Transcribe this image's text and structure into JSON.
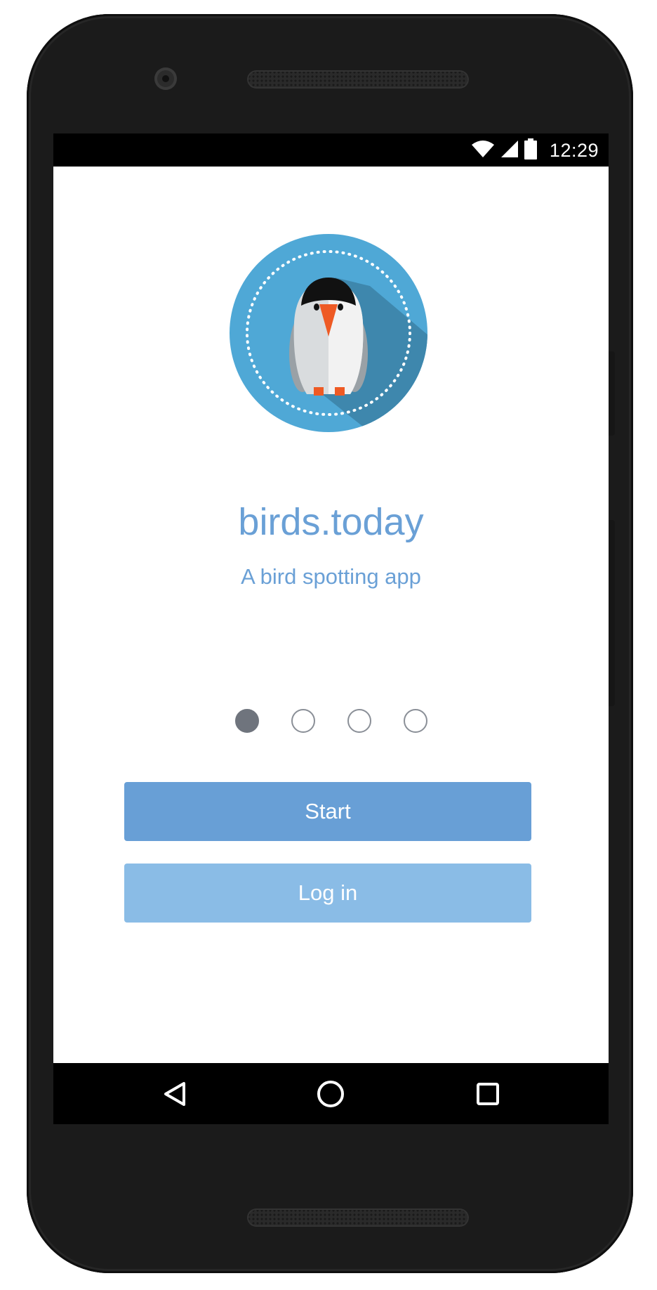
{
  "status_bar": {
    "time": "12:29",
    "icons": [
      "wifi-icon",
      "signal-icon",
      "battery-icon"
    ]
  },
  "app": {
    "name": "birds.today",
    "tagline": "A bird spotting app",
    "logo_icon": "bird-logo-icon"
  },
  "pager": {
    "page_count": 4,
    "active_page": 1
  },
  "actions": {
    "start_label": "Start",
    "login_label": "Log in"
  },
  "nav_bar": {
    "icons": [
      "back-icon",
      "home-icon",
      "recents-icon"
    ]
  },
  "colors": {
    "brand_blue": "#6aa0d6",
    "start_button": "#689fd6",
    "login_button": "#8abce6",
    "logo_circle": "#4fa8d6",
    "logo_shadow": "#3e87ad",
    "beak": "#ee5a24"
  }
}
